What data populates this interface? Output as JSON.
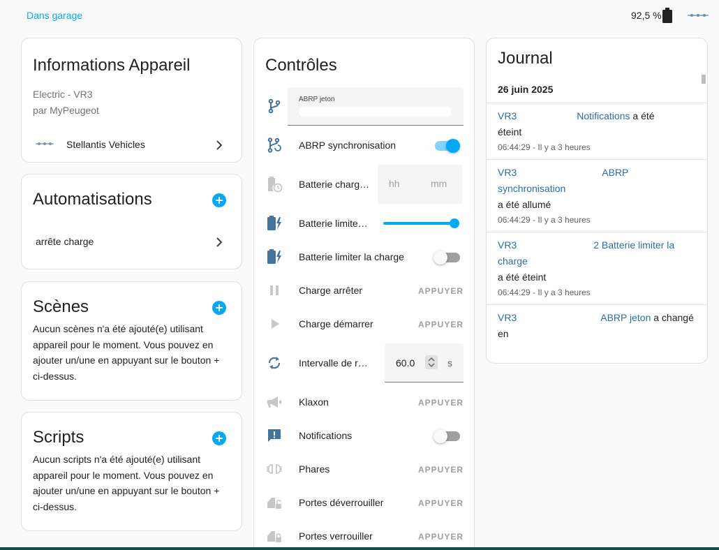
{
  "topbar": {
    "area": "Dans garage",
    "battery": "92,5 %"
  },
  "info": {
    "title": "Informations Appareil",
    "model": "Electric - VR3",
    "manufacturer": "par MyPeugeot",
    "integration": "Stellantis Vehicles"
  },
  "automations": {
    "title": "Automatisations",
    "items": [
      {
        "label": "arrête charge"
      }
    ]
  },
  "scenes": {
    "title": "Scènes",
    "empty": "Aucun scènes n'a été ajouté(e) utilisant appareil pour le moment. Vous pouvez en ajouter un/une en appuyant sur le bouton + ci-dessus."
  },
  "scripts": {
    "title": "Scripts",
    "empty": "Aucun scripts n'a été ajouté(e) utilisant appareil pour le moment. Vous pouvez en ajouter un/une en appuyant sur le bouton + ci-dessus."
  },
  "controls": {
    "title": "Contrôles",
    "abrp_token_label": "ABRP jeton",
    "abrp_sync": "ABRP synchronisation",
    "battery_charge_time": "Batterie charg…",
    "time_hh": "hh",
    "time_mm": "mm",
    "battery_limit_value": "Batterie limite…",
    "battery_limit_level": 1.0,
    "battery_limit_charge": "Batterie limiter la charge",
    "charge_stop": "Charge arrêter",
    "charge_start": "Charge démarrer",
    "refresh_interval": "Intervalle de r…",
    "refresh_value": "60.0",
    "refresh_unit": "s",
    "horn": "Klaxon",
    "notifications": "Notifications",
    "lights": "Phares",
    "doors_unlock": "Portes déverrouiller",
    "doors_lock": "Portes verrouiller",
    "press": "APPUYER",
    "abrp_sync_on": true,
    "battery_limit_charge_on": false,
    "notifications_on": false
  },
  "journal": {
    "title": "Journal",
    "date": "26 juin 2025",
    "entries": [
      {
        "prefix": "VR3",
        "entity": "Notifications",
        "action_1": " a été",
        "action_2": "éteint",
        "time": "06:44:29 - Il y a 3 heures"
      },
      {
        "prefix": "VR3",
        "entity": "ABRP",
        "entity_2": "synchronisation",
        "action": "a été allumé",
        "time": "06:44:29 - Il y a 3 heures"
      },
      {
        "prefix": "VR3",
        "entity": "2 Batterie limiter la",
        "entity_2": "charge",
        "action": "a été éteint",
        "time": "06:44:29 - Il y a 3 heures"
      },
      {
        "prefix": "VR3",
        "entity": "ABRP jeton",
        "action_1": " a changé",
        "action_2": "en"
      }
    ]
  },
  "colors": {
    "accent": "#03a9f4",
    "icon": "#44739e",
    "icon_muted": "#c7c7c7"
  }
}
